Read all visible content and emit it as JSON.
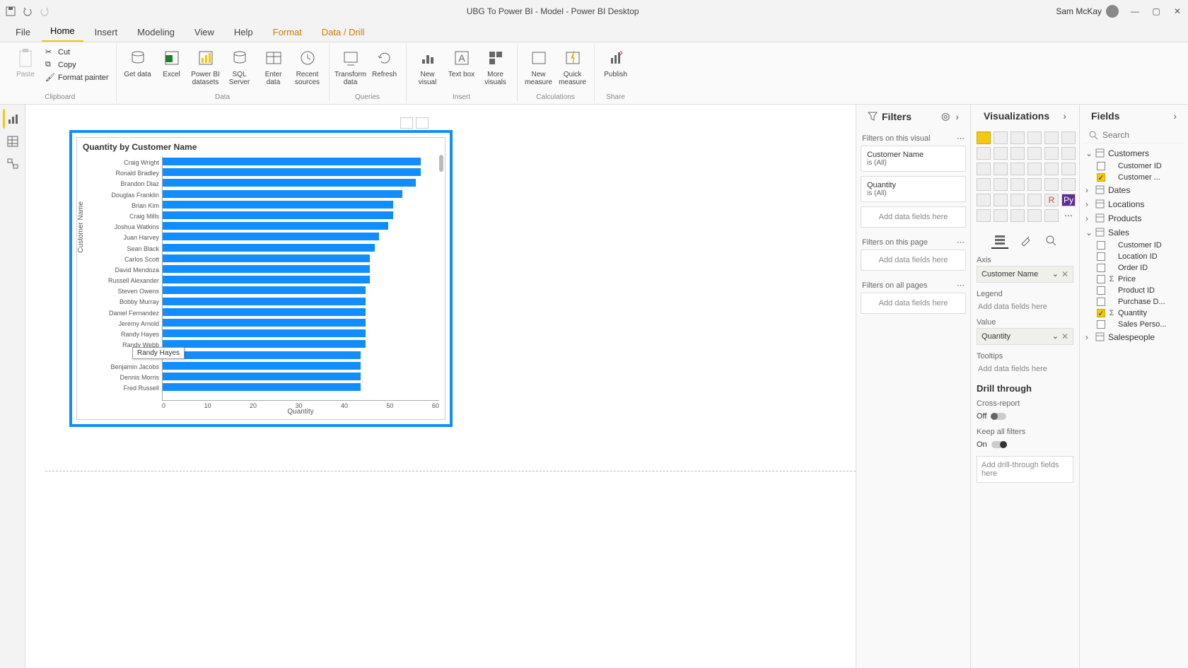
{
  "titlebar": {
    "title": "UBG To Power BI - Model - Power BI Desktop",
    "user": "Sam McKay"
  },
  "tabs": [
    "File",
    "Home",
    "Insert",
    "Modeling",
    "View",
    "Help",
    "Format",
    "Data / Drill"
  ],
  "ribbon": {
    "clipboard": {
      "paste": "Paste",
      "cut": "Cut",
      "copy": "Copy",
      "painter": "Format painter",
      "group": "Clipboard"
    },
    "data": {
      "get": "Get data",
      "excel": "Excel",
      "pbi": "Power BI datasets",
      "sql": "SQL Server",
      "enter": "Enter data",
      "recent": "Recent sources",
      "group": "Data"
    },
    "queries": {
      "transform": "Transform data",
      "refresh": "Refresh",
      "group": "Queries"
    },
    "insert": {
      "newvis": "New visual",
      "text": "Text box",
      "more": "More visuals",
      "group": "Insert"
    },
    "calc": {
      "newmeas": "New measure",
      "quick": "Quick measure",
      "group": "Calculations"
    },
    "share": {
      "publish": "Publish",
      "group": "Share"
    }
  },
  "chart_data": {
    "type": "bar",
    "title": "Quantity by Customer Name",
    "xlabel": "Quantity",
    "ylabel": "Customer Name",
    "xlim": [
      0,
      60
    ],
    "xticks": [
      0,
      10,
      20,
      30,
      40,
      50,
      60
    ],
    "categories": [
      "Craig Wright",
      "Ronald Bradley",
      "Brandon Diaz",
      "Douglas Franklin",
      "Brian Kim",
      "Craig Mills",
      "Joshua Watkins",
      "Juan Harvey",
      "Sean Black",
      "Carlos Scott",
      "David Mendoza",
      "Russell Alexander",
      "Steven Owens",
      "Bobby Murray",
      "Daniel Fernandez",
      "Jeremy Arnold",
      "Randy Hayes",
      "Randy Webb",
      "",
      "Benjamin Jacobs",
      "Dennis Morris",
      "Fred Russell"
    ],
    "values": [
      56,
      56,
      55,
      52,
      50,
      50,
      49,
      47,
      46,
      45,
      45,
      45,
      44,
      44,
      44,
      44,
      44,
      44,
      43,
      43,
      43,
      43
    ],
    "tooltip": "Randy Hayes"
  },
  "filters": {
    "title": "Filters",
    "on_visual": "Filters on this visual",
    "visual_filters": [
      {
        "name": "Customer Name",
        "value": "is (All)"
      },
      {
        "name": "Quantity",
        "value": "is (All)"
      }
    ],
    "add": "Add data fields here",
    "on_page": "Filters on this page",
    "on_all": "Filters on all pages"
  },
  "viz": {
    "title": "Visualizations",
    "axis": "Axis",
    "axis_field": "Customer Name",
    "legend": "Legend",
    "legend_ph": "Add data fields here",
    "value": "Value",
    "value_field": "Quantity",
    "tooltips": "Tooltips",
    "tooltips_ph": "Add data fields here",
    "drill": "Drill through",
    "cross": "Cross-report",
    "cross_state": "Off",
    "keep": "Keep all filters",
    "keep_state": "On",
    "drill_ph": "Add drill-through fields here"
  },
  "fields": {
    "title": "Fields",
    "search_ph": "Search",
    "tables": [
      {
        "name": "Customers",
        "expanded": true,
        "fields": [
          {
            "name": "Customer ID",
            "checked": false
          },
          {
            "name": "Customer ...",
            "checked": true
          }
        ]
      },
      {
        "name": "Dates",
        "expanded": false
      },
      {
        "name": "Locations",
        "expanded": false
      },
      {
        "name": "Products",
        "expanded": false
      },
      {
        "name": "Sales",
        "expanded": true,
        "fields": [
          {
            "name": "Customer ID",
            "checked": false
          },
          {
            "name": "Location ID",
            "checked": false
          },
          {
            "name": "Order ID",
            "checked": false
          },
          {
            "name": "Price",
            "checked": false,
            "sigma": true
          },
          {
            "name": "Product ID",
            "checked": false
          },
          {
            "name": "Purchase D...",
            "checked": false
          },
          {
            "name": "Quantity",
            "checked": true,
            "sigma": true
          },
          {
            "name": "Sales Perso...",
            "checked": false
          }
        ]
      },
      {
        "name": "Salespeople",
        "expanded": false
      }
    ]
  }
}
